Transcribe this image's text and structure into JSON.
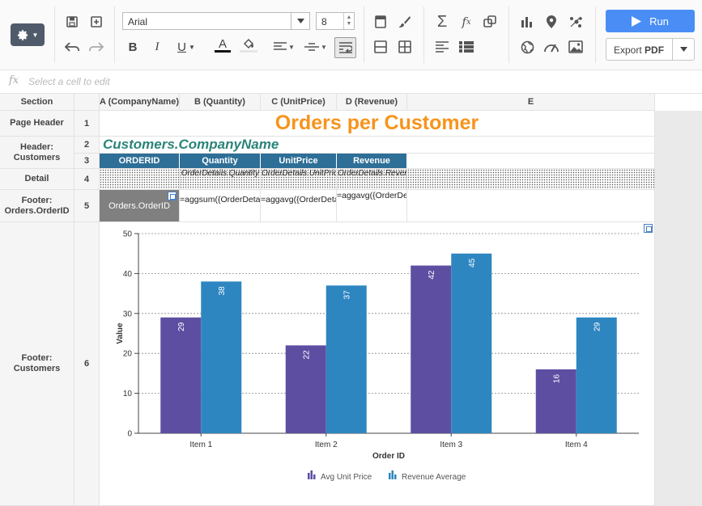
{
  "toolbar": {
    "font_family": "Arial",
    "font_size": "8",
    "run_label": "Run",
    "export_label": "Export",
    "export_format": "PDF"
  },
  "formula_bar": {
    "icon": "fx",
    "placeholder": "Select a cell to edit"
  },
  "columns": {
    "section": "Section",
    "a": "A (CompanyName)",
    "b": "B (Quantity)",
    "c": "C (UnitPrice)",
    "d": "D (Revenue)",
    "e": "E"
  },
  "sections": {
    "page_header": "Page Header",
    "header_customers": "Header: Customers",
    "detail": "Detail",
    "footer_orderid": "Footer: Orders.OrderID",
    "footer_customers": "Footer: Customers"
  },
  "rows": [
    "1",
    "2",
    "3",
    "4",
    "5",
    "6"
  ],
  "cells": {
    "title": "Orders per Customer",
    "company": "Customers.CompanyName",
    "th_orderid": "ORDERID",
    "th_quantity": "Quantity",
    "th_unitprice": "UnitPrice",
    "th_revenue": "Revenue",
    "detail_quantity": "OrderDetails.Quantity",
    "detail_unitprice": "OrderDetails.UnitPrice",
    "detail_revenue": "OrderDetails.Revenue",
    "footer_orderid": "Orders.OrderID",
    "footer_quantity": "=aggsum({OrderDetails.Quantity})",
    "footer_unitprice": "=aggavg({OrderDetails.UnitPrice})",
    "footer_revenue": "=aggavg({OrderDetails.Revenue})"
  },
  "colors": {
    "title": "#f7941d",
    "company": "#2a8478",
    "table_header": "#2e6f97",
    "run_button": "#4a8ef5",
    "series_1": "#5e4ea2",
    "series_2": "#2e86c1"
  },
  "chart_data": {
    "type": "bar",
    "categories": [
      "Item 1",
      "Item 2",
      "Item 3",
      "Item 4"
    ],
    "series": [
      {
        "name": "Avg Unit Price",
        "values": [
          29,
          22,
          42,
          16
        ]
      },
      {
        "name": "Revenue Average",
        "values": [
          38,
          37,
          45,
          29
        ]
      }
    ],
    "xlabel": "Order ID",
    "ylabel": "Value",
    "ylim": [
      0,
      50
    ],
    "yticks": [
      0,
      10,
      20,
      30,
      40,
      50
    ],
    "grid": true,
    "legend_position": "bottom"
  }
}
